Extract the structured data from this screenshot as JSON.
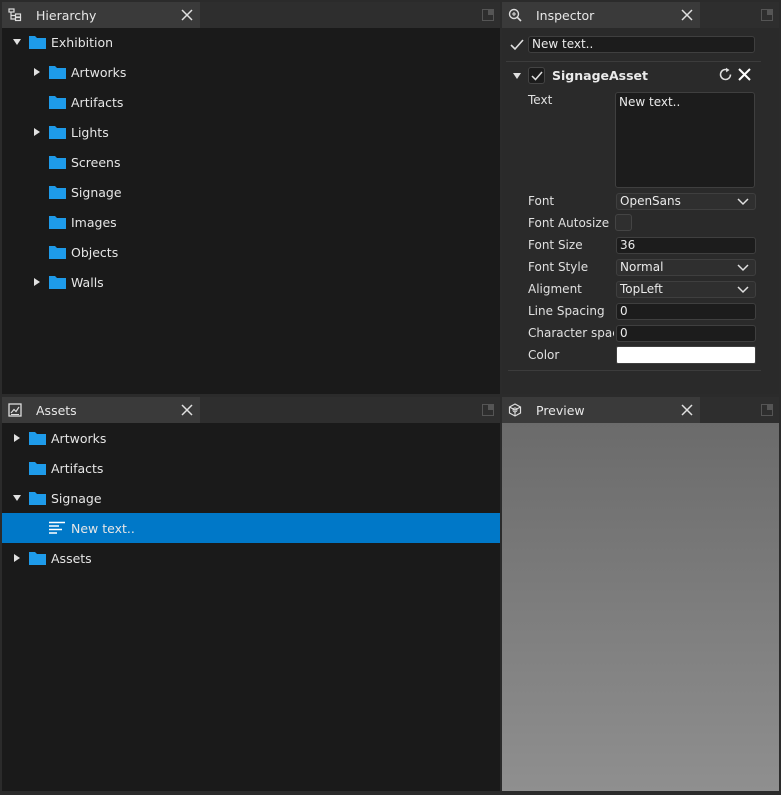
{
  "hierarchy": {
    "title": "Hierarchy",
    "items": [
      {
        "label": "Exhibition",
        "expanded": true
      },
      {
        "label": "Artworks",
        "expandable": true
      },
      {
        "label": "Artifacts"
      },
      {
        "label": "Lights",
        "expandable": true
      },
      {
        "label": "Screens"
      },
      {
        "label": "Signage"
      },
      {
        "label": "Images"
      },
      {
        "label": "Objects"
      },
      {
        "label": "Walls",
        "expandable": true
      }
    ]
  },
  "inspector": {
    "title": "Inspector",
    "object_name": "New text..",
    "component": {
      "name": "SignageAsset",
      "fields": {
        "text_label": "Text",
        "text_value": "New text..",
        "font_label": "Font",
        "font_value": "OpenSans",
        "font_autosize_label": "Font Autosize",
        "font_size_label": "Font Size",
        "font_size_value": "36",
        "font_style_label": "Font Style",
        "font_style_value": "Normal",
        "alignment_label": "Aligment",
        "alignment_value": "TopLeft",
        "line_spacing_label": "Line Spacing",
        "line_spacing_value": "0",
        "character_spacing_label": "Character spaci",
        "character_spacing_value": "0",
        "color_label": "Color",
        "color_value": "#ffffff"
      }
    }
  },
  "assets": {
    "title": "Assets",
    "items": [
      {
        "label": "Artworks",
        "expandable": true
      },
      {
        "label": "Artifacts"
      },
      {
        "label": "Signage",
        "expanded": true
      },
      {
        "label": "New text..",
        "selected": true
      },
      {
        "label": "Assets",
        "expandable": true
      }
    ]
  },
  "preview": {
    "title": "Preview"
  },
  "colors": {
    "accent": "#0078c8",
    "folder": "#1e9bea"
  }
}
